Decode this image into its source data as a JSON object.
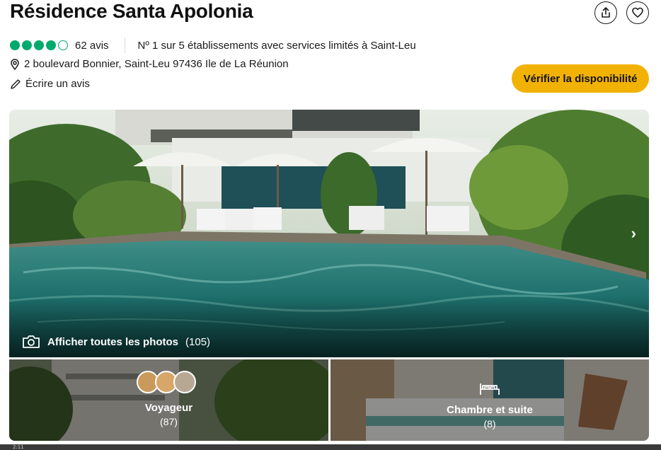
{
  "hotel": {
    "name": "Résidence Santa Apolonia",
    "rating": 4,
    "rating_max": 5,
    "reviews": "62 avis",
    "ranking": "Nº 1 sur 5 établissements avec services limités à Saint-Leu",
    "address": "2 boulevard Bonnier, Saint-Leu 97436 Ile de La Réunion",
    "write_review": "Écrire un avis"
  },
  "actions": {
    "check_availability": "Vérifier la disponibilité",
    "share_icon": "share-icon",
    "save_icon": "heart-icon"
  },
  "gallery": {
    "all_photos": "Afficher toutes les photos",
    "all_photos_count": "(105)",
    "tiles": [
      {
        "label": "Voyageur",
        "count": "(87)"
      },
      {
        "label": "Chambre et suite",
        "count": "(8)"
      }
    ]
  },
  "taskbar": {
    "time": "2:11"
  },
  "colors": {
    "rating_green": "#00aa6c",
    "cta_yellow": "#f2b203"
  }
}
